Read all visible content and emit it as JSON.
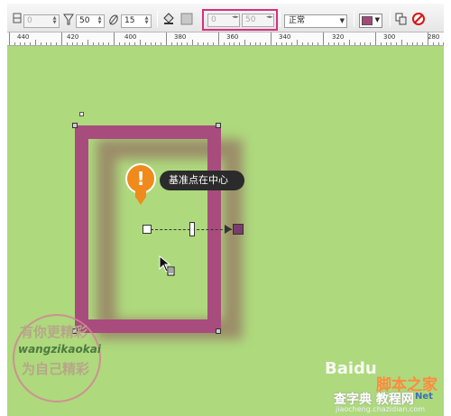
{
  "toolbar": {
    "field1_value": "0",
    "field2_value": "50",
    "field3_value": "15",
    "transparency_start_value": "0",
    "transparency_end_value": "50",
    "merge_mode": "正常",
    "fill_color": "#a24a78"
  },
  "ruler": {
    "labels": [
      "440",
      "420",
      "400",
      "380",
      "360",
      "340",
      "320",
      "300",
      "280"
    ]
  },
  "canvas": {
    "background_color": "#aed97d",
    "frame_color": "#a84c7d",
    "tooltip_text": "基准点在中心"
  },
  "watermarks": {
    "stamp_line1": "有你更精彩",
    "stamp_line2": "wangzikaokai",
    "stamp_line3": "为自己精彩",
    "baidu_logo": "Baidu",
    "site_cn": "脚本之家",
    "site_cn2": "查字典 教程网",
    "site_url": "jiaocheng.chazidian.com",
    "net_text": "Net"
  }
}
